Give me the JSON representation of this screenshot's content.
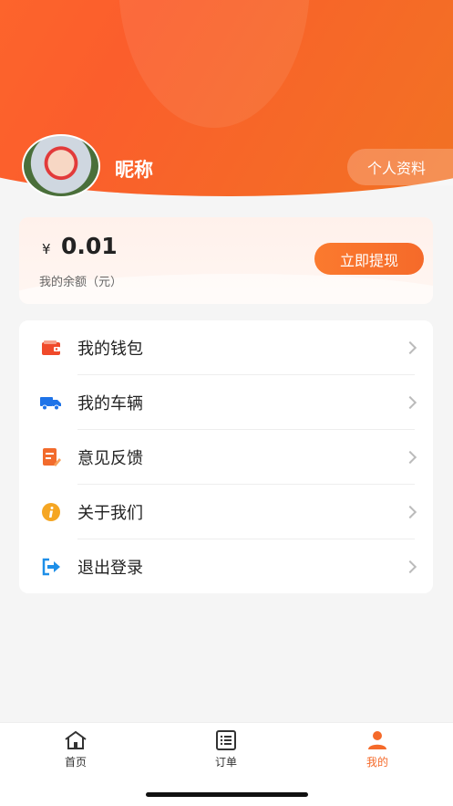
{
  "header": {
    "nickname": "昵称",
    "profile_button": "个人资料"
  },
  "balance": {
    "currency_symbol": "¥",
    "amount": "0.01",
    "label": "我的余额（元）",
    "withdraw_button": "立即提现"
  },
  "menu": {
    "items": [
      {
        "label": "我的钱包",
        "icon": "wallet-icon",
        "color": "#f04a2a"
      },
      {
        "label": "我的车辆",
        "icon": "truck-icon",
        "color": "#1e73e8"
      },
      {
        "label": "意见反馈",
        "icon": "feedback-icon",
        "color": "#f26b2c"
      },
      {
        "label": "关于我们",
        "icon": "info-icon",
        "color": "#f5a623"
      },
      {
        "label": "退出登录",
        "icon": "logout-icon",
        "color": "#1e8fe8"
      }
    ]
  },
  "tabbar": {
    "tabs": [
      {
        "label": "首页",
        "icon": "home-icon"
      },
      {
        "label": "订单",
        "icon": "list-icon"
      },
      {
        "label": "我的",
        "icon": "user-icon",
        "active": true
      }
    ],
    "active_color": "#f56a2a"
  },
  "colors": {
    "brand": "#f56a2a",
    "header_gradient_start": "#ff6a2c",
    "header_gradient_end": "#f07522"
  }
}
